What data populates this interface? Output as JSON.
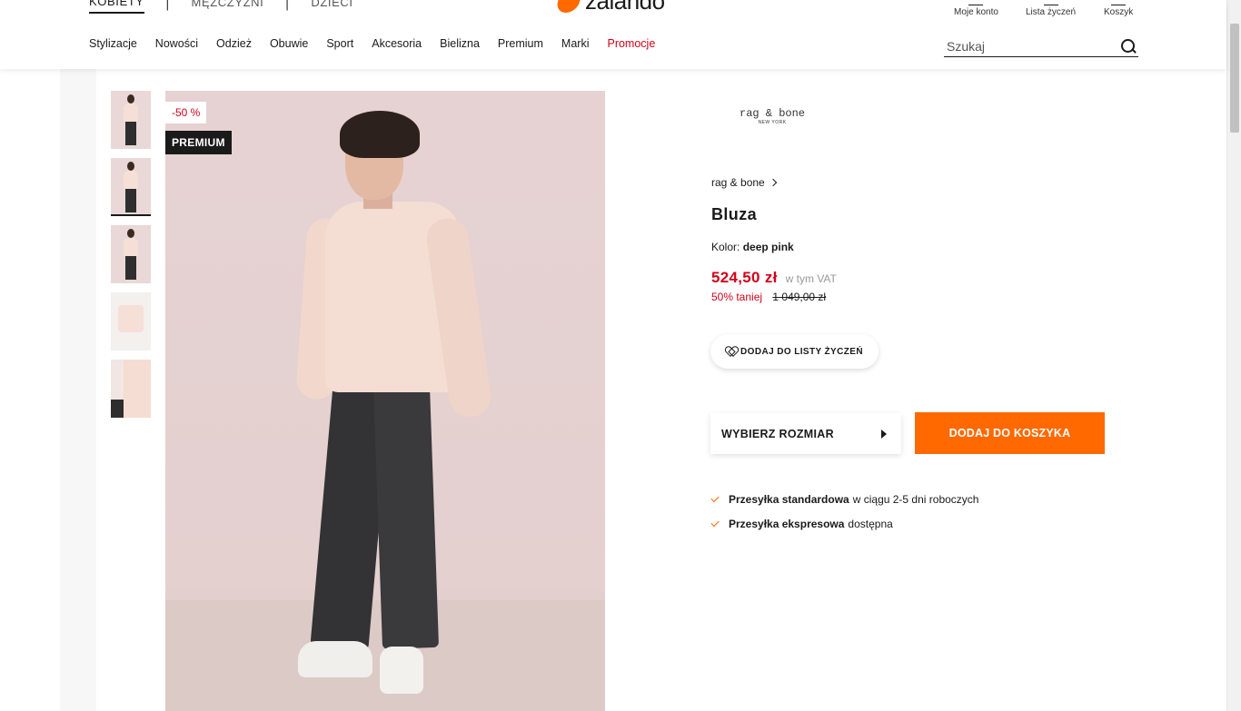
{
  "header": {
    "gender_tabs": [
      "KOBIETY",
      "MĘŻCZYŹNI",
      "DZIECI"
    ],
    "logo_text": "zalando",
    "account": {
      "label": "Moje konto",
      "icon": "user-icon"
    },
    "wishlist": {
      "label": "Lista życzeń",
      "icon": "heart-icon"
    },
    "cart": {
      "label": "Koszyk",
      "icon": "bag-icon"
    },
    "nav": [
      "Stylizacje",
      "Nowości",
      "Odzież",
      "Obuwie",
      "Sport",
      "Akcesoria",
      "Bielizna",
      "Premium",
      "Marki",
      "Promocje"
    ],
    "search": {
      "placeholder": "Szukaj",
      "value": ""
    }
  },
  "gallery": {
    "discount_badge": "-50 %",
    "premium_badge": "PREMIUM",
    "thumbnail_count": 5
  },
  "product": {
    "brand_logo_text": "rag & bone",
    "brand_logo_sub": "NEW YORK",
    "brand": "rag & bone",
    "title": "Bluza",
    "color_label": "Kolor:",
    "color_value": "deep pink",
    "price": "524,50 zł",
    "vat_note": "w tym VAT",
    "discount_text": "50% taniej",
    "old_price": "1 049,00 zł",
    "wishlist_button": "DODAJ DO LISTY ŻYCZEŃ",
    "size_select": "WYBIERZ ROZMIAR",
    "add_to_cart": "DODAJ DO KOSZYKA",
    "shipping": [
      {
        "bold": "Przesyłka standardowa",
        "rest": "w ciągu 2-5 dni roboczych"
      },
      {
        "bold": "Przesyłka ekspresowa",
        "rest": "dostępna"
      }
    ]
  },
  "colors": {
    "accent": "#ff6900",
    "sale_red": "#d0021b"
  }
}
